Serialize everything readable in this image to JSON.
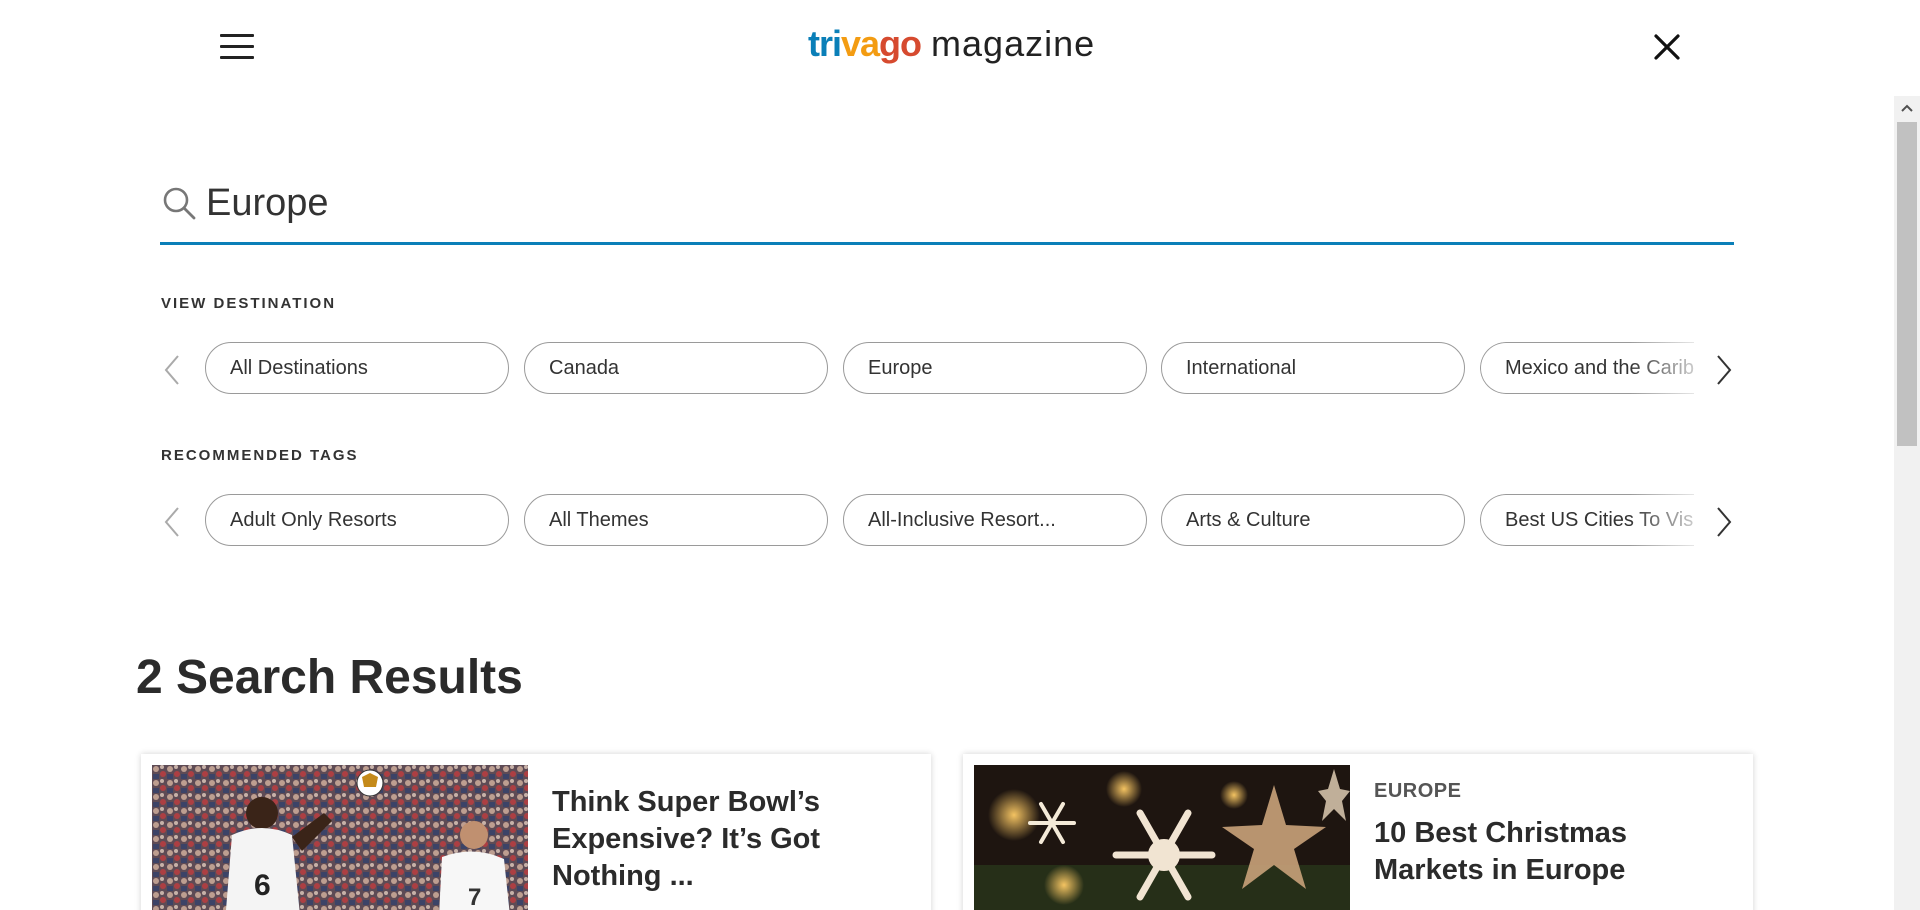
{
  "header": {
    "logo_brand_parts": [
      "tri",
      "va",
      "go"
    ],
    "logo_suffix": "magazine",
    "menu_icon": "hamburger-menu-icon",
    "close_icon": "close-icon"
  },
  "search": {
    "value": "Europe",
    "icon": "search-icon",
    "underline_color": "#0a7fb8"
  },
  "destinations": {
    "label": "VIEW DESTINATION",
    "items": [
      "All Destinations",
      "Canada",
      "Europe",
      "International",
      "Mexico and the Caribbean"
    ]
  },
  "tags": {
    "label": "RECOMMENDED TAGS",
    "items": [
      "Adult Only Resorts",
      "All Themes",
      "All-Inclusive Resort...",
      "Arts & Culture",
      "Best US Cities To Visit"
    ]
  },
  "results": {
    "heading": "2 Search Results",
    "cards": [
      {
        "category": "",
        "title_lines": [
          "Think Super Bowl’s",
          "Expensive? It’s Got",
          "Nothing ..."
        ]
      },
      {
        "category": "EUROPE",
        "title_lines": [
          "10 Best Christmas",
          "Markets in Europe"
        ]
      }
    ]
  },
  "colors": {
    "brand_blue": "#0a7fb8",
    "brand_orange": "#f39c12",
    "brand_red": "#d64a2f"
  }
}
